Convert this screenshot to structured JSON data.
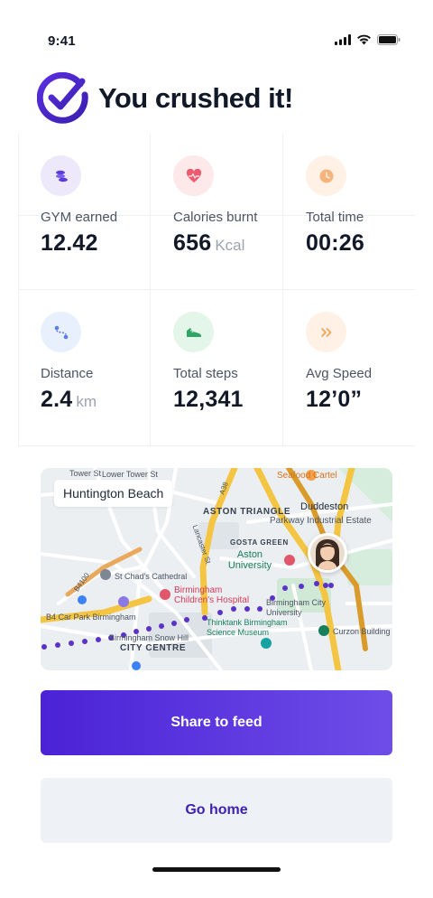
{
  "status_bar": {
    "time": "9:41",
    "icons": [
      "signal-icon",
      "wifi-icon",
      "battery-icon"
    ]
  },
  "header": {
    "title": "You crushed it!",
    "logo": "checkmark-logo"
  },
  "stats": [
    {
      "label": "GYM earned",
      "value": "12.42",
      "unit": "",
      "icon": "coins-icon",
      "icon_bg": "#ede9fb",
      "icon_color": "#5b3be0"
    },
    {
      "label": "Calories burnt",
      "value": "656",
      "unit": "Kcal",
      "icon": "heart-pulse-icon",
      "icon_bg": "#fde8ea",
      "icon_color": "#ef5b6e"
    },
    {
      "label": "Total time",
      "value": "00:26",
      "unit": "",
      "icon": "clock-icon",
      "icon_bg": "#fff1e6",
      "icon_color": "#f3a35b"
    },
    {
      "label": "Distance",
      "value": "2.4",
      "unit": "km",
      "icon": "route-icon",
      "icon_bg": "#e8f0fe",
      "icon_color": "#5b7cf0"
    },
    {
      "label": "Total steps",
      "value": "12,341",
      "unit": "",
      "icon": "sneaker-icon",
      "icon_bg": "#e4f5ea",
      "icon_color": "#2fa565"
    },
    {
      "label": "Avg Speed",
      "value": "12’0”",
      "unit": "",
      "icon": "fast-forward-icon",
      "icon_bg": "#fff1e6",
      "icon_color": "#f3a35b"
    }
  ],
  "map": {
    "location_label": "Huntington Beach",
    "labels": {
      "tower_st": "Tower St",
      "lower_tower_st": "Lower Tower St",
      "seafood_cartel": "Seafood Cartel",
      "aston_triangle": "ASTON TRIANGLE",
      "duddeston": "Duddeston",
      "parkway": "Parkway Industrial Estate",
      "gosta_green": "GOSTA GREEN",
      "aston_university": "Aston University",
      "chads": "St Chad's Cathedral",
      "childrens": "Birmingham Children's Hospital",
      "bcu": "Birmingham City University",
      "car_park": "B4 Car Park Birmingham",
      "thinktank": "Thinktank Birmingham Science Museum",
      "curzon": "Curzon Building",
      "snow_hill": "Birmingham Snow Hill",
      "city_centre": "CITY CENTRE",
      "a38": "A38",
      "b4100": "B4100",
      "lancaster_st": "Lancaster St"
    }
  },
  "actions": {
    "share_label": "Share to feed",
    "home_label": "Go home"
  },
  "colors": {
    "accent": "#4b22d6",
    "route": "#5b32c9"
  }
}
